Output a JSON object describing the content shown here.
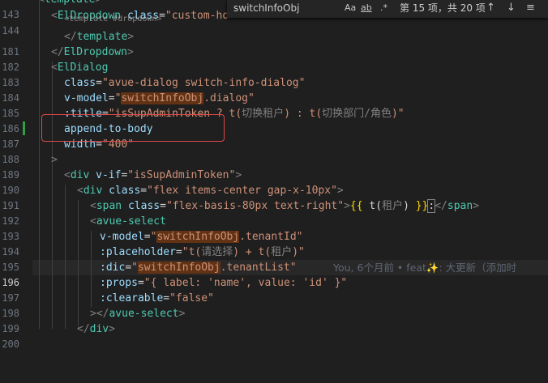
{
  "find": {
    "query": "switchInfoObj",
    "match_case": "Aa",
    "whole_word": "ab",
    "regex": ".*",
    "count": "第 15 项，共 20 项",
    "prev_icon": "arrow-up",
    "next_icon": "arrow-down",
    "more_icon": "menu"
  },
  "lines": {
    "l143": {
      "num": "143",
      "open": "<",
      "tag": "template",
      "close": ">"
    },
    "l144": {
      "num": "144",
      "open": "<",
      "tag": "ElDropdown",
      "attr": "class",
      "eq": "=",
      "val": "\"custom-ho"
    },
    "l144b": {
      "text": "<template #dropdown>"
    },
    "l181": {
      "num": "181",
      "open": "</",
      "tag": "template",
      "close": ">"
    },
    "l182": {
      "num": "182",
      "open": "</",
      "tag": "ElDropdown",
      "close": ">"
    },
    "l183": {
      "num": "183",
      "open": "<",
      "tag": "ElDialog"
    },
    "l184": {
      "num": "184",
      "attr": "class",
      "eq": "=",
      "val": "\"avue-dialog switch-info-dialog\""
    },
    "l185": {
      "num": "185",
      "attr": "v-model",
      "eq": "=",
      "q1": "\"",
      "match": "switchInfoObj",
      "rest": ".dialog\""
    },
    "l186": {
      "num": "186",
      "attr": ":title",
      "eq": "=",
      "v1": "\"isSupAdminToken ? t(",
      "cn1": "切换租户",
      "v2": ") : t(",
      "cn2": "切换部门/角色",
      "v3": ")\""
    },
    "l187": {
      "num": "187",
      "attr": "append-to-body"
    },
    "l188": {
      "num": "188",
      "attr": "width",
      "eq": "=",
      "val": "\"400\""
    },
    "l189": {
      "num": "189",
      "close": ">"
    },
    "l190": {
      "num": "190",
      "open": "<",
      "tag": "div",
      "attr": "v-if",
      "eq": "=",
      "val": "\"isSupAdminToken\"",
      "close": ">"
    },
    "l191": {
      "num": "191",
      "open": "<",
      "tag": "div",
      "attr": "class",
      "eq": "=",
      "val": "\"flex items-center gap-x-10px\"",
      "close": ">"
    },
    "l192": {
      "num": "192",
      "open": "<",
      "tag": "span",
      "attr": "class",
      "eq": "=",
      "val": "\"flex-basis-80px text-right\"",
      "close": ">",
      "b1": "{{",
      "t1": " t(",
      "cn": "租户",
      "t2": ") ",
      "b2": "}}",
      "colon": ":",
      "end_open": "</",
      "end_tag": "span",
      "end_close": ">"
    },
    "l193": {
      "num": "193",
      "open": "<",
      "tag": "avue-select"
    },
    "l194": {
      "num": "194",
      "attr": "v-model",
      "eq": "=",
      "q1": "\"",
      "match": "switchInfoObj",
      "rest": ".tenantId\""
    },
    "l195": {
      "num": "195",
      "attr": ":placeholder",
      "eq": "=",
      "v1": "\"t(",
      "cn1": "请选择",
      "v2": ") + t(",
      "cn2": "租户",
      "v3": ")\""
    },
    "l196": {
      "num": "196",
      "attr": ":dic",
      "eq": "=",
      "q1": "\"",
      "match": "switchInfoObj",
      "rest": ".tenantList\"",
      "blame": "You, 6个月前 • feat✨: 大更新（添加时"
    },
    "l197": {
      "num": "197",
      "attr": ":props",
      "eq": "=",
      "val": "\"{ label: 'name', value: 'id' }\""
    },
    "l198": {
      "num": "198",
      "attr": ":clearable",
      "eq": "=",
      "val": "\"false\""
    },
    "l199": {
      "num": "199",
      "open": "></",
      "tag": "avue-select",
      "close": ">"
    },
    "l200": {
      "num": "200",
      "open": "</",
      "tag": "div",
      "close": ">"
    }
  }
}
